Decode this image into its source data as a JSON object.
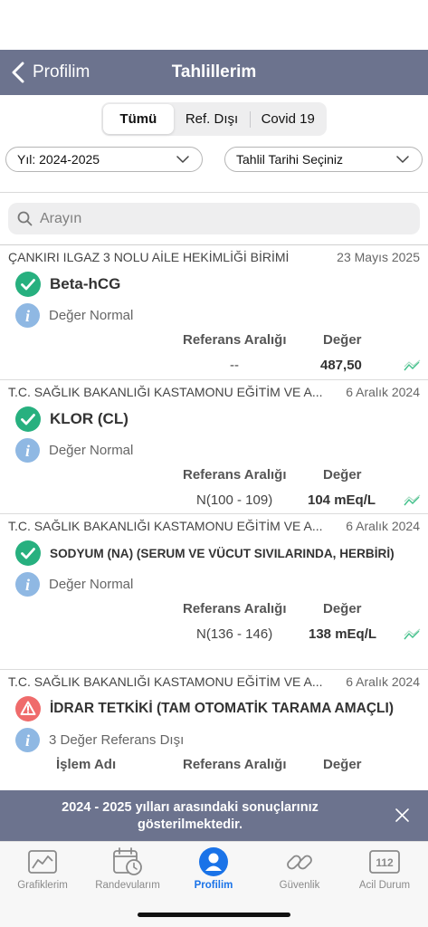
{
  "navbar": {
    "back_label": "Profilim",
    "title": "Tahlillerim"
  },
  "segments": [
    {
      "label": "Tümü",
      "active": true
    },
    {
      "label": "Ref. Dışı",
      "active": false
    },
    {
      "label": "Covid 19",
      "active": false
    }
  ],
  "filters": {
    "year": "Yıl: 2024-2025",
    "date": "Tahlil Tarihi Seçiniz"
  },
  "search": {
    "placeholder": "Arayın"
  },
  "results": [
    {
      "institution": "ÇANKIRI ILGAZ 3 NOLU AİLE HEKİMLİĞİ BİRİMİ",
      "date": "23 Mayıs 2025",
      "status": "ok",
      "test": "Beta-hCG",
      "info": "Değer Normal",
      "ref_label": "Referans Aralığı",
      "value_label": "Değer",
      "ref": "--",
      "value": "487,50"
    },
    {
      "institution": "T.C. SAĞLIK BAKANLIĞI KASTAMONU EĞİTİM VE A...",
      "date": "6 Aralık 2024",
      "status": "ok",
      "test": "KLOR (CL)",
      "info": "Değer Normal",
      "ref_label": "Referans Aralığı",
      "value_label": "Değer",
      "ref": "N(100 - 109)",
      "value": "104 mEq/L"
    },
    {
      "institution": "T.C. SAĞLIK BAKANLIĞI KASTAMONU EĞİTİM VE A...",
      "date": "6 Aralık 2024",
      "status": "ok",
      "test": "SODYUM (NA) (SERUM VE VÜCUT SIVILARINDA, HERBİRİ)",
      "info": "Değer Normal",
      "ref_label": "Referans Aralığı",
      "value_label": "Değer",
      "ref": "N(136 - 146)",
      "value": "138 mEq/L"
    },
    {
      "institution": "T.C. SAĞLIK BAKANLIĞI KASTAMONU EĞİTİM VE A...",
      "date": "6 Aralık 2024",
      "status": "warning",
      "test": "İDRAR TETKİKİ (TAM OTOMATİK TARAMA AMAÇLI)",
      "info": "3 Değer Referans Dışı",
      "name_label": "İşlem Adı",
      "ref_label": "Referans Aralığı",
      "value_label": "Değer"
    }
  ],
  "banner": {
    "text": "2024 - 2025 yılları arasındaki sonuçlarınız gösterilmektedir."
  },
  "tabs": [
    {
      "label": "Grafiklerim",
      "icon": "chart-icon"
    },
    {
      "label": "Randevularım",
      "icon": "calendar-clock-icon"
    },
    {
      "label": "Profilim",
      "icon": "profile-icon",
      "active": true
    },
    {
      "label": "Güvenlik",
      "icon": "link-icon"
    },
    {
      "label": "Acil Durum",
      "icon": "emergency-112-icon",
      "badge": "112"
    }
  ],
  "colors": {
    "nav": "#6c738e",
    "ok": "#27b07f",
    "warning": "#ef6b6b",
    "info": "#8fb8e3",
    "active_tab": "#1a73e8"
  }
}
